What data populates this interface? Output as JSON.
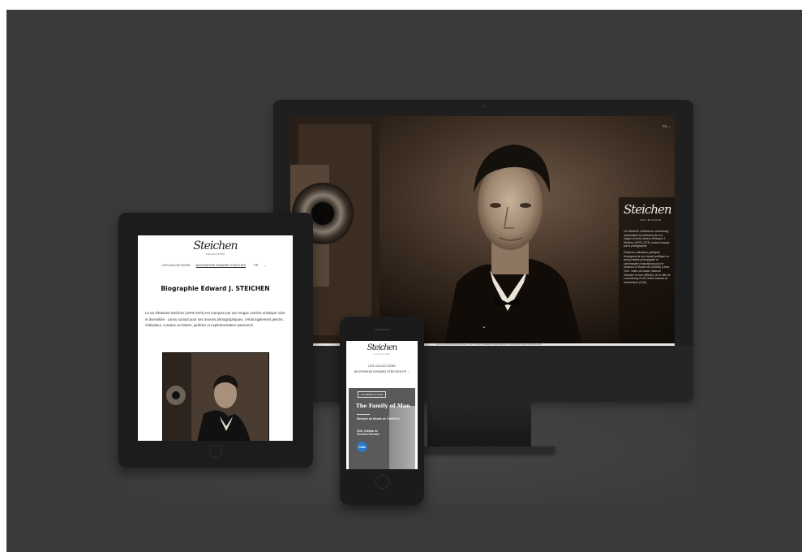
{
  "desktop": {
    "lang": "FR",
    "logo_text": "Steichen",
    "logo_sub": "COLLECTIONS",
    "intro": [
      "Les Steichen Collections Luxembourg rassemblent le patrimoine lié à la longue et riche carrière d'Edward J. Steichen (1879–1973), surtout marqué par la photographie.",
      "Plusieurs collections publiques témoignent de son travail prolifique en tant qu'artiste photographe et commissaire d'expositions pour le Museum of Modern Art (MoMA) à New York : celles du Musée national d'histoire et d'art (MNHA), de la Ville de Luxembourg et du Centre national de l'audiovisuel (CNA)."
    ],
    "caption": "Steichen, Self Portrait with Camera, c. 1917 © 2019 The Estate of Edward Steichen / Artists Rights Society (ARS) New York"
  },
  "tablet": {
    "logo_text": "Steichen",
    "logo_sub": "COLLECTIONS",
    "nav": {
      "collections": "LES COLLECTIONS",
      "biography": "BIOGRAPHIE EDWARD STEICHEN",
      "lang": "FR"
    },
    "title": "Biographie Edward J. STEICHEN",
    "body": "La vie d'Edward Steichen (1879-1973) est marquée par une longue carrière artistique riche et diversifiée : connu surtout pour ses œuvres photographiques, il était également peintre, réalisateur, curateur au MoMA, jardinier et expérimentateur passionné."
  },
  "phone": {
    "logo_text": "Steichen",
    "logo_sub": "COLLECTIONS",
    "nav_collections": "LES COLLECTIONS",
    "nav_biography": "BIOGRAPHIE EDWARD STEICHEN",
    "lang": "FR",
    "card": {
      "tag": "ACCÉDER AU SITE",
      "title": "The Family of Man",
      "subtitle": "Mémoire du Monde de l'UNESCO",
      "place": "CNA, Château de Clervaux Clervaux",
      "badge": "CNA"
    }
  },
  "colors": {
    "background": "#3a3a3a",
    "device": "#1f1f1f",
    "sepia_dark": "#1e140d",
    "badge_blue": "#2f78c4"
  }
}
